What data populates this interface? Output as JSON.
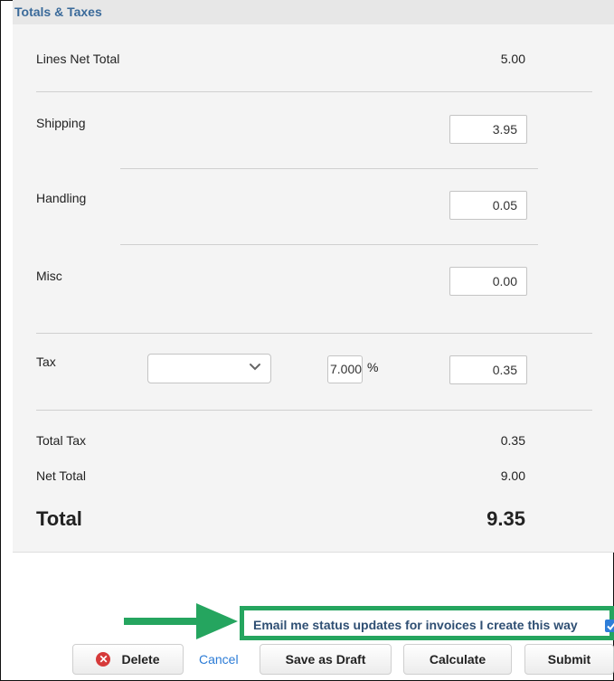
{
  "section": {
    "title": "Totals & Taxes"
  },
  "rows": {
    "lines_net_total": {
      "label": "Lines Net Total",
      "value": "5.00"
    },
    "shipping": {
      "label": "Shipping",
      "value": "3.95"
    },
    "handling": {
      "label": "Handling",
      "value": "0.05"
    },
    "misc": {
      "label": "Misc",
      "value": "0.00"
    },
    "tax": {
      "label": "Tax",
      "select_value": "",
      "percent": "7.000",
      "percent_sign": "%",
      "value": "0.35"
    },
    "total_tax": {
      "label": "Total Tax",
      "value": "0.35"
    },
    "net_total": {
      "label": "Net Total",
      "value": "9.00"
    },
    "total": {
      "label": "Total",
      "value": "9.35"
    }
  },
  "email_option": {
    "label": "Email me status updates for invoices I create this way",
    "checked": true
  },
  "actions": {
    "delete": "Delete",
    "cancel": "Cancel",
    "save_draft": "Save as Draft",
    "calculate": "Calculate",
    "submit": "Submit"
  },
  "colors": {
    "highlight": "#25a55f",
    "link": "#2b7bd6",
    "title": "#3a6a9a"
  },
  "icons": {
    "delete": "x-circle-icon",
    "tax_dropdown": "chevron-down-icon",
    "annotation": "arrow-right-icon"
  }
}
